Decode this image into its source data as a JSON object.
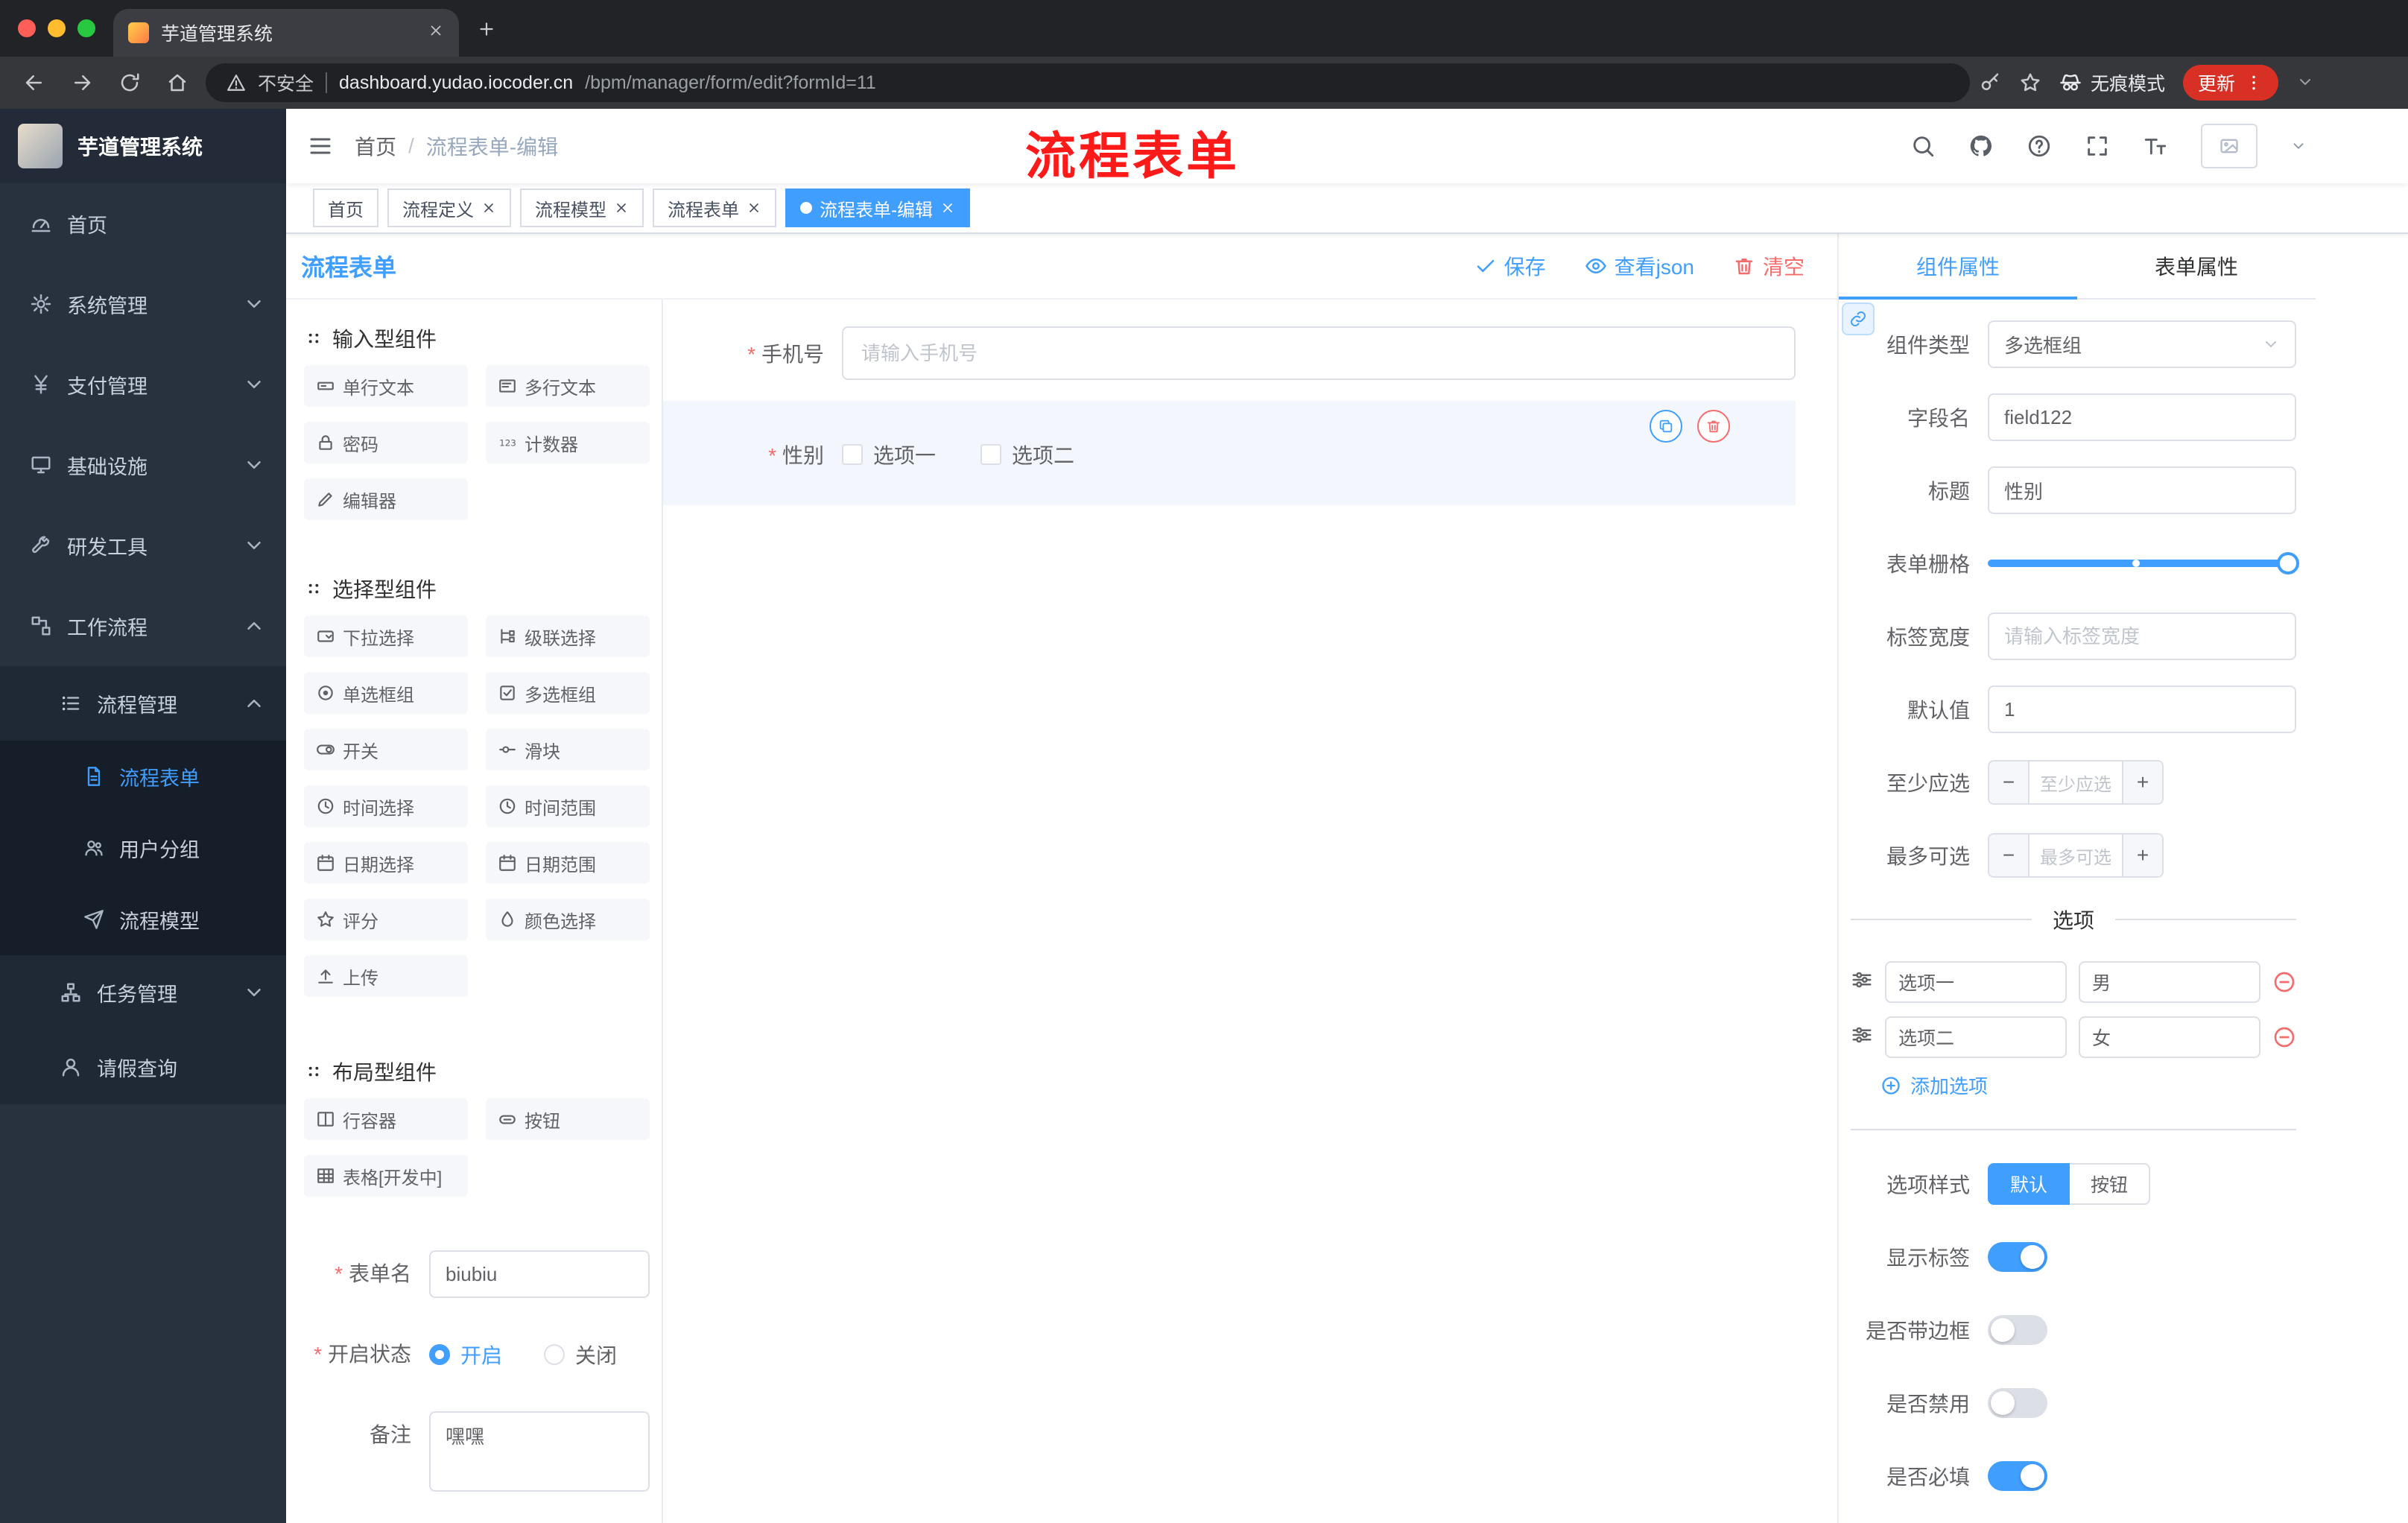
{
  "browser": {
    "tab": {
      "title": "芋道管理系统"
    },
    "address": {
      "security": "不安全",
      "host": "dashboard.yudao.iocoder.cn",
      "path": "/bpm/manager/form/edit?formId=11"
    },
    "incognito_label": "无痕模式",
    "update_label": "更新"
  },
  "sidebar": {
    "logo_title": "芋道管理系统",
    "menu": [
      {
        "label": "首页"
      },
      {
        "label": "系统管理"
      },
      {
        "label": "支付管理"
      },
      {
        "label": "基础设施"
      },
      {
        "label": "研发工具"
      },
      {
        "label": "工作流程"
      }
    ],
    "workflow": {
      "process_mgmt": {
        "label": "流程管理",
        "children": [
          {
            "label": "流程表单"
          },
          {
            "label": "用户分组"
          },
          {
            "label": "流程模型"
          }
        ]
      },
      "task_mgmt": {
        "label": "任务管理"
      },
      "leave_query": {
        "label": "请假查询"
      }
    }
  },
  "navbar": {
    "breadcrumb": [
      "首页",
      "流程表单-编辑"
    ],
    "separator": "/",
    "annotation": "流程表单"
  },
  "tags": [
    {
      "label": "首页"
    },
    {
      "label": "流程定义"
    },
    {
      "label": "流程模型"
    },
    {
      "label": "流程表单"
    },
    {
      "label": "流程表单-编辑"
    }
  ],
  "designer": {
    "title": "流程表单",
    "actions": {
      "save": "保存",
      "view_json": "查看json",
      "clear": "清空"
    },
    "palette": {
      "sections": [
        {
          "title": "输入型组件",
          "items": [
            {
              "label": "单行文本"
            },
            {
              "label": "多行文本"
            },
            {
              "label": "密码"
            },
            {
              "label": "计数器"
            },
            {
              "label": "编辑器"
            }
          ]
        },
        {
          "title": "选择型组件",
          "items": [
            {
              "label": "下拉选择"
            },
            {
              "label": "级联选择"
            },
            {
              "label": "单选框组"
            },
            {
              "label": "多选框组"
            },
            {
              "label": "开关"
            },
            {
              "label": "滑块"
            },
            {
              "label": "时间选择"
            },
            {
              "label": "时间范围"
            },
            {
              "label": "日期选择"
            },
            {
              "label": "日期范围"
            },
            {
              "label": "评分"
            },
            {
              "label": "颜色选择"
            },
            {
              "label": "上传"
            }
          ]
        },
        {
          "title": "布局型组件",
          "items": [
            {
              "label": "行容器"
            },
            {
              "label": "按钮"
            },
            {
              "label": "表格[开发中]"
            }
          ]
        }
      ]
    },
    "meta_form": {
      "name_label": "表单名",
      "name_value": "biubiu",
      "status_label": "开启状态",
      "status_on": "开启",
      "status_off": "关闭",
      "remark_label": "备注",
      "remark_value": "嘿嘿"
    },
    "canvas": {
      "phone": {
        "label": "手机号",
        "placeholder": "请输入手机号"
      },
      "gender": {
        "label": "性别",
        "options": [
          "选项一",
          "选项二"
        ]
      }
    }
  },
  "props": {
    "tabs": {
      "component": "组件属性",
      "form": "表单属性"
    },
    "rows": {
      "type_label": "组件类型",
      "type_value": "多选框组",
      "field_label": "字段名",
      "field_value": "field122",
      "title_label": "标题",
      "title_value": "性别",
      "grid_label": "表单栅格",
      "label_width_label": "标签宽度",
      "label_width_placeholder": "请输入标签宽度",
      "default_label": "默认值",
      "default_value": "1",
      "min_label": "至少应选",
      "min_placeholder": "至少应选",
      "max_label": "最多可选",
      "max_placeholder": "最多可选"
    },
    "options_divider": "选项",
    "options": [
      {
        "label": "选项一",
        "value": "男"
      },
      {
        "label": "选项二",
        "value": "女"
      }
    ],
    "add_option": "添加选项",
    "style_label": "选项样式",
    "style_default": "默认",
    "style_button": "按钮",
    "switches": [
      {
        "label": "显示标签",
        "on": true
      },
      {
        "label": "是否带边框",
        "on": false
      },
      {
        "label": "是否禁用",
        "on": false
      },
      {
        "label": "是否必填",
        "on": true
      }
    ],
    "stepper": {
      "minus": "−",
      "plus": "+"
    }
  },
  "colors": {
    "accent": "#409eff",
    "danger": "#f56c6c"
  }
}
